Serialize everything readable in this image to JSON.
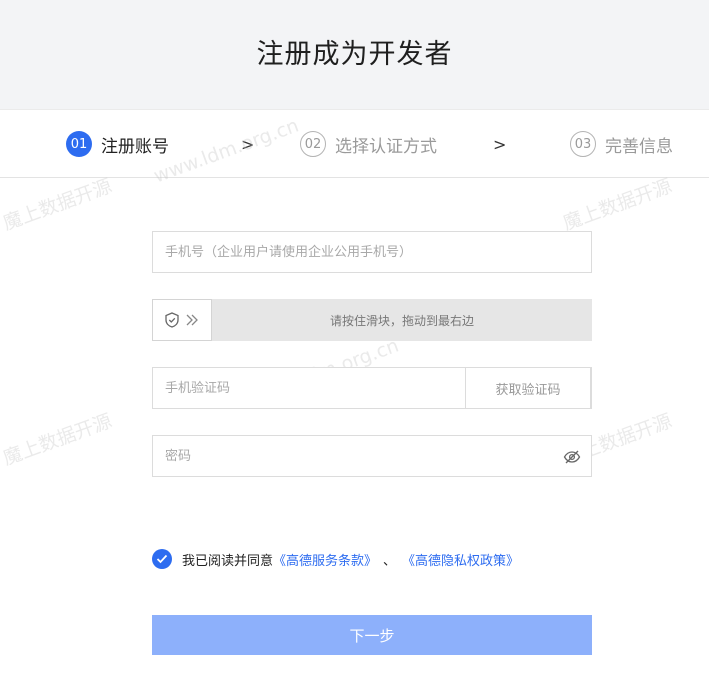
{
  "header": {
    "title": "注册成为开发者"
  },
  "steps": [
    {
      "number": "01",
      "label": "注册账号",
      "state": "active"
    },
    {
      "number": "02",
      "label": "选择认证方式",
      "state": "inactive"
    },
    {
      "number": "03",
      "label": "完善信息",
      "state": "inactive"
    }
  ],
  "step_separator": ">",
  "form": {
    "phone_placeholder": "手机号（企业用户请使用企业公用手机号）",
    "slider_text": "请按住滑块，拖动到最右边",
    "code_placeholder": "手机验证码",
    "get_code_label": "获取验证码",
    "password_placeholder": "密码"
  },
  "agreement": {
    "checked": true,
    "prefix": "我已阅读并同意",
    "terms_link": "《高德服务条款》",
    "separator": "、",
    "privacy_link": "《高德隐私权政策》"
  },
  "next_button": "下一步",
  "watermarks": [
    "魔上数据开源",
    "www.ldm.org.cn"
  ],
  "colors": {
    "accent": "#2d6cf0",
    "button_disabled": "#8db0fb",
    "header_bg": "#f3f4f6"
  }
}
